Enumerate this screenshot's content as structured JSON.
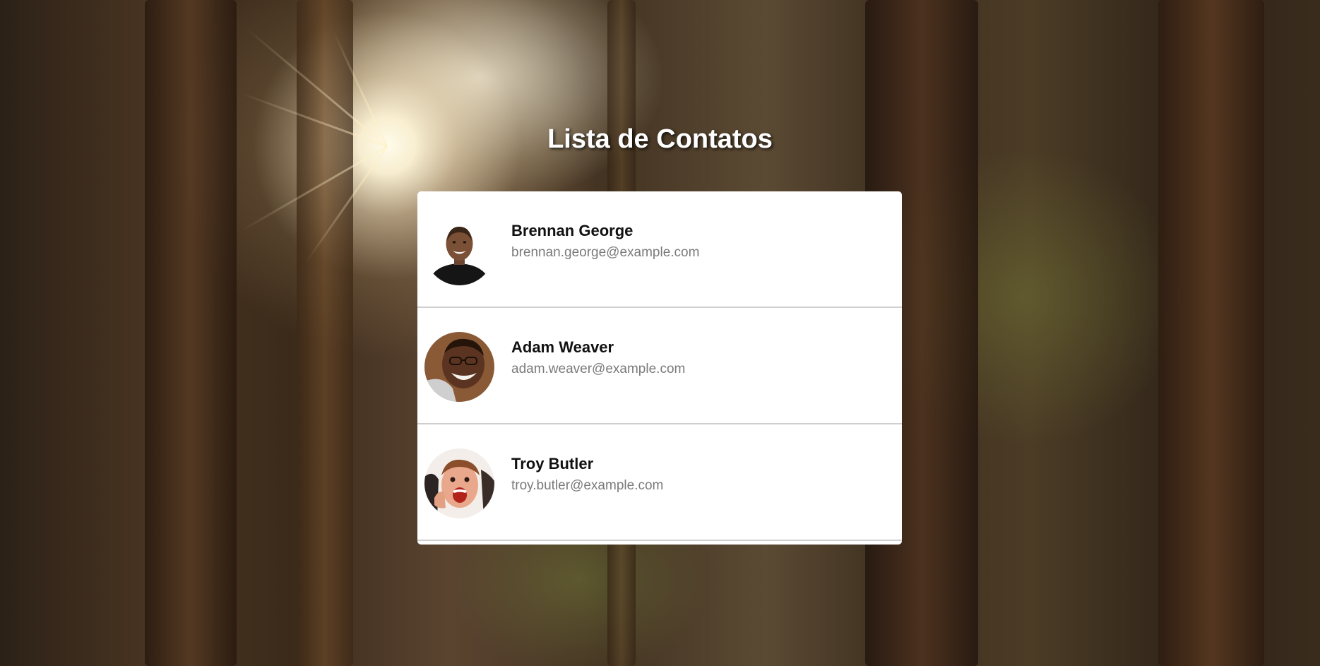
{
  "page": {
    "title": "Lista de Contatos"
  },
  "contacts": [
    {
      "name": "Brennan George",
      "email": "brennan.george@example.com",
      "avatar_icon": "avatar-photo-smiling-man-black-shirt"
    },
    {
      "name": "Adam Weaver",
      "email": "adam.weaver@example.com",
      "avatar_icon": "avatar-photo-smiling-man-glasses"
    },
    {
      "name": "Troy Butler",
      "email": "troy.butler@example.com",
      "avatar_icon": "avatar-photo-excited-man-thumbs-up"
    }
  ],
  "colors": {
    "card_background": "#ffffff",
    "title_text": "#ffffff",
    "name_text": "#111111",
    "email_text": "#7a7a7a",
    "divider": "#cfcfcf"
  }
}
